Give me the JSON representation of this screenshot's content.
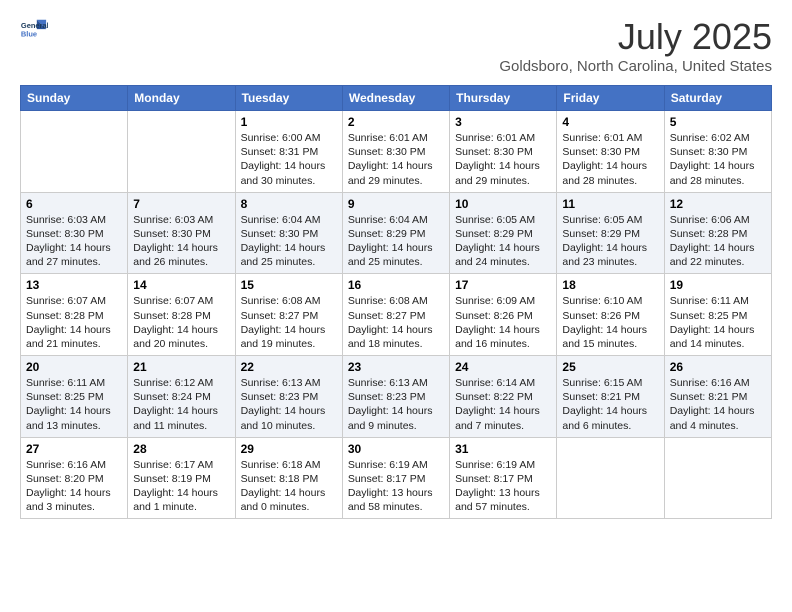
{
  "logo": {
    "line1": "General",
    "line2": "Blue"
  },
  "title": "July 2025",
  "location": "Goldsboro, North Carolina, United States",
  "days_of_week": [
    "Sunday",
    "Monday",
    "Tuesday",
    "Wednesday",
    "Thursday",
    "Friday",
    "Saturday"
  ],
  "weeks": [
    [
      {
        "day": "",
        "info": ""
      },
      {
        "day": "",
        "info": ""
      },
      {
        "day": "1",
        "info": "Sunrise: 6:00 AM\nSunset: 8:31 PM\nDaylight: 14 hours and 30 minutes."
      },
      {
        "day": "2",
        "info": "Sunrise: 6:01 AM\nSunset: 8:30 PM\nDaylight: 14 hours and 29 minutes."
      },
      {
        "day": "3",
        "info": "Sunrise: 6:01 AM\nSunset: 8:30 PM\nDaylight: 14 hours and 29 minutes."
      },
      {
        "day": "4",
        "info": "Sunrise: 6:01 AM\nSunset: 8:30 PM\nDaylight: 14 hours and 28 minutes."
      },
      {
        "day": "5",
        "info": "Sunrise: 6:02 AM\nSunset: 8:30 PM\nDaylight: 14 hours and 28 minutes."
      }
    ],
    [
      {
        "day": "6",
        "info": "Sunrise: 6:03 AM\nSunset: 8:30 PM\nDaylight: 14 hours and 27 minutes."
      },
      {
        "day": "7",
        "info": "Sunrise: 6:03 AM\nSunset: 8:30 PM\nDaylight: 14 hours and 26 minutes."
      },
      {
        "day": "8",
        "info": "Sunrise: 6:04 AM\nSunset: 8:30 PM\nDaylight: 14 hours and 25 minutes."
      },
      {
        "day": "9",
        "info": "Sunrise: 6:04 AM\nSunset: 8:29 PM\nDaylight: 14 hours and 25 minutes."
      },
      {
        "day": "10",
        "info": "Sunrise: 6:05 AM\nSunset: 8:29 PM\nDaylight: 14 hours and 24 minutes."
      },
      {
        "day": "11",
        "info": "Sunrise: 6:05 AM\nSunset: 8:29 PM\nDaylight: 14 hours and 23 minutes."
      },
      {
        "day": "12",
        "info": "Sunrise: 6:06 AM\nSunset: 8:28 PM\nDaylight: 14 hours and 22 minutes."
      }
    ],
    [
      {
        "day": "13",
        "info": "Sunrise: 6:07 AM\nSunset: 8:28 PM\nDaylight: 14 hours and 21 minutes."
      },
      {
        "day": "14",
        "info": "Sunrise: 6:07 AM\nSunset: 8:28 PM\nDaylight: 14 hours and 20 minutes."
      },
      {
        "day": "15",
        "info": "Sunrise: 6:08 AM\nSunset: 8:27 PM\nDaylight: 14 hours and 19 minutes."
      },
      {
        "day": "16",
        "info": "Sunrise: 6:08 AM\nSunset: 8:27 PM\nDaylight: 14 hours and 18 minutes."
      },
      {
        "day": "17",
        "info": "Sunrise: 6:09 AM\nSunset: 8:26 PM\nDaylight: 14 hours and 16 minutes."
      },
      {
        "day": "18",
        "info": "Sunrise: 6:10 AM\nSunset: 8:26 PM\nDaylight: 14 hours and 15 minutes."
      },
      {
        "day": "19",
        "info": "Sunrise: 6:11 AM\nSunset: 8:25 PM\nDaylight: 14 hours and 14 minutes."
      }
    ],
    [
      {
        "day": "20",
        "info": "Sunrise: 6:11 AM\nSunset: 8:25 PM\nDaylight: 14 hours and 13 minutes."
      },
      {
        "day": "21",
        "info": "Sunrise: 6:12 AM\nSunset: 8:24 PM\nDaylight: 14 hours and 11 minutes."
      },
      {
        "day": "22",
        "info": "Sunrise: 6:13 AM\nSunset: 8:23 PM\nDaylight: 14 hours and 10 minutes."
      },
      {
        "day": "23",
        "info": "Sunrise: 6:13 AM\nSunset: 8:23 PM\nDaylight: 14 hours and 9 minutes."
      },
      {
        "day": "24",
        "info": "Sunrise: 6:14 AM\nSunset: 8:22 PM\nDaylight: 14 hours and 7 minutes."
      },
      {
        "day": "25",
        "info": "Sunrise: 6:15 AM\nSunset: 8:21 PM\nDaylight: 14 hours and 6 minutes."
      },
      {
        "day": "26",
        "info": "Sunrise: 6:16 AM\nSunset: 8:21 PM\nDaylight: 14 hours and 4 minutes."
      }
    ],
    [
      {
        "day": "27",
        "info": "Sunrise: 6:16 AM\nSunset: 8:20 PM\nDaylight: 14 hours and 3 minutes."
      },
      {
        "day": "28",
        "info": "Sunrise: 6:17 AM\nSunset: 8:19 PM\nDaylight: 14 hours and 1 minute."
      },
      {
        "day": "29",
        "info": "Sunrise: 6:18 AM\nSunset: 8:18 PM\nDaylight: 14 hours and 0 minutes."
      },
      {
        "day": "30",
        "info": "Sunrise: 6:19 AM\nSunset: 8:17 PM\nDaylight: 13 hours and 58 minutes."
      },
      {
        "day": "31",
        "info": "Sunrise: 6:19 AM\nSunset: 8:17 PM\nDaylight: 13 hours and 57 minutes."
      },
      {
        "day": "",
        "info": ""
      },
      {
        "day": "",
        "info": ""
      }
    ]
  ]
}
